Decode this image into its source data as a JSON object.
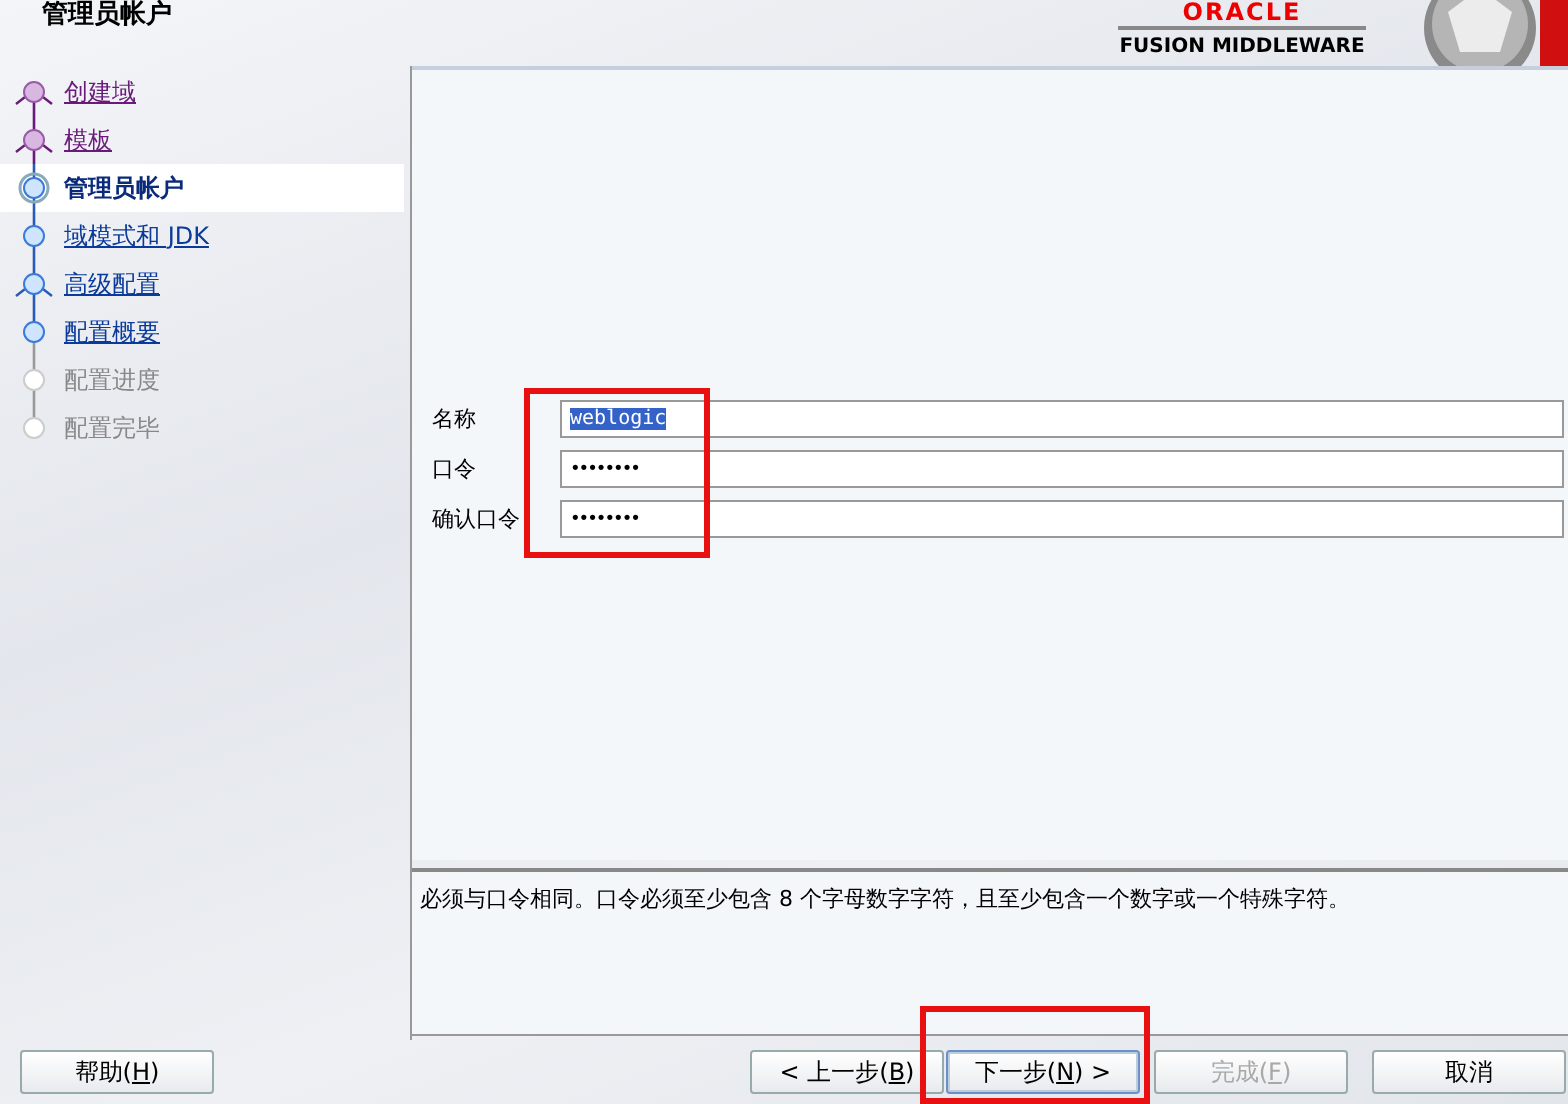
{
  "window": {
    "title": "管理员帐户"
  },
  "brand": {
    "logo": "ORACLE",
    "product": "FUSION MIDDLEWARE"
  },
  "steps": [
    {
      "label": "创建域",
      "visited": true,
      "enabled": true,
      "branch": true,
      "selected": false
    },
    {
      "label": "模板",
      "visited": true,
      "enabled": true,
      "branch": true,
      "selected": false
    },
    {
      "label": "管理员帐户",
      "visited": false,
      "enabled": true,
      "branch": false,
      "selected": true
    },
    {
      "label": "域模式和 JDK",
      "visited": false,
      "enabled": true,
      "branch": false,
      "selected": false
    },
    {
      "label": "高级配置",
      "visited": false,
      "enabled": true,
      "branch": true,
      "selected": false
    },
    {
      "label": "配置概要",
      "visited": false,
      "enabled": true,
      "branch": false,
      "selected": false
    },
    {
      "label": "配置进度",
      "visited": false,
      "enabled": false,
      "branch": false,
      "selected": false
    },
    {
      "label": "配置完毕",
      "visited": false,
      "enabled": false,
      "branch": false,
      "selected": false
    }
  ],
  "form": [
    {
      "label": "名称",
      "kind": "text",
      "value": "weblogic",
      "text_selected": true
    },
    {
      "label": "口令",
      "kind": "password",
      "value": "••••••••",
      "text_selected": false
    },
    {
      "label": "确认口令",
      "kind": "password",
      "value": "••••••••",
      "text_selected": false
    }
  ],
  "description": "必须与口令相同。口令必须至少包含 8 个字母数字字符，且至少包含一个数字或一个特殊字符。",
  "buttons": [
    {
      "label": "帮助(H)",
      "kind": "help",
      "disabled": false,
      "focused": false
    },
    {
      "label": "< 上一步(B)",
      "kind": "nav",
      "disabled": false,
      "focused": false
    },
    {
      "label": "下一步(N) >",
      "kind": "nav",
      "disabled": false,
      "focused": true
    },
    {
      "label": "完成(F)",
      "kind": "nav",
      "disabled": true,
      "focused": false
    },
    {
      "label": "取消",
      "kind": "cancel",
      "disabled": false,
      "focused": false
    }
  ]
}
